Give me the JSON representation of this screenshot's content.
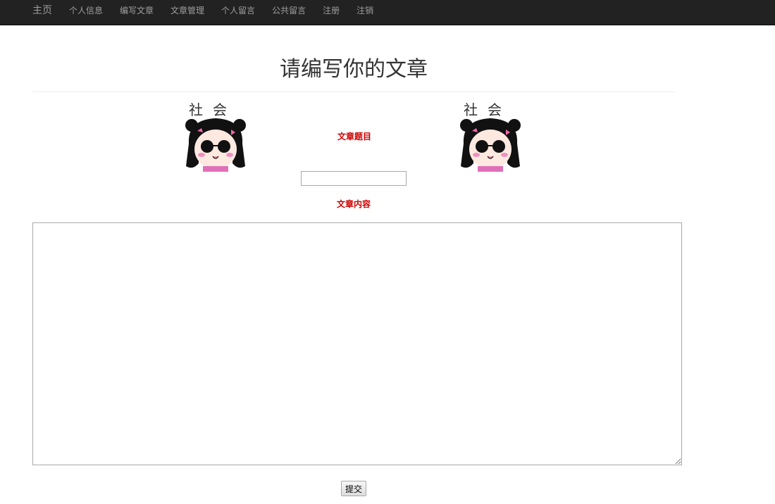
{
  "nav": {
    "brand": "主页",
    "items": [
      {
        "label": "个人信息"
      },
      {
        "label": "编写文章"
      },
      {
        "label": "文章管理"
      },
      {
        "label": "个人留言"
      },
      {
        "label": "公共留言"
      },
      {
        "label": "注册"
      },
      {
        "label": "注销"
      }
    ]
  },
  "page_title": "请编写你的文章",
  "stickers": {
    "caption": "社会"
  },
  "form": {
    "title_label": "文章题目",
    "title_value": "",
    "content_label": "文章内容",
    "content_value": "",
    "submit_label": "提交"
  },
  "colors": {
    "navbar_bg": "#222222",
    "nav_text": "#9d9d9d",
    "label_red": "#cc0000"
  }
}
